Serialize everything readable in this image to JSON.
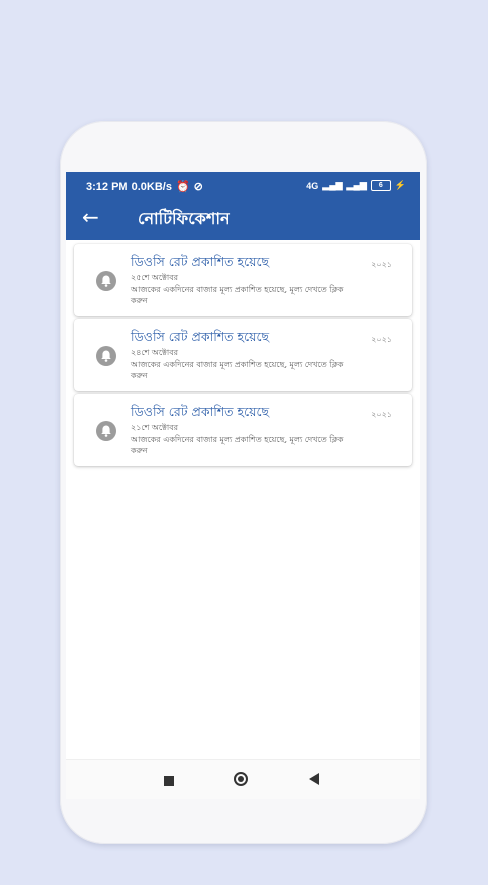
{
  "status": {
    "time": "3:12 PM",
    "speed": "0.0KB/s",
    "signal": "4G",
    "battery": "6"
  },
  "appbar": {
    "title": "নোটিফিকেশান"
  },
  "notifications": [
    {
      "title": "ডিওসি রেট প্রকাশিত হয়েছে",
      "date": "২৫শে অক্টোবর",
      "body": "আজকের একদিনের বাজার মূল্য প্রকাশিত হয়েছে, মূল্য দেখতে ক্লিক করুন",
      "year": "২০২১"
    },
    {
      "title": "ডিওসি রেট প্রকাশিত হয়েছে",
      "date": "২৪শে অক্টোবর",
      "body": "আজকের একদিনের বাজার মূল্য প্রকাশিত হয়েছে, মূল্য দেখতে ক্লিক করুন",
      "year": "২০২১"
    },
    {
      "title": "ডিওসি রেট প্রকাশিত হয়েছে",
      "date": "২১শে অক্টোবর",
      "body": "আজকের একদিনের বাজার মূল্য প্রকাশিত হয়েছে, মূল্য দেখতে ক্লিক করুন",
      "year": "২০২১"
    }
  ],
  "colors": {
    "primary": "#2a5ca8",
    "background": "#dfe4f6",
    "bell": "#9c9c9c"
  },
  "icons": {
    "back": "arrow-left-icon",
    "bell": "bell-icon",
    "nav_recent": "square-icon",
    "nav_home": "circle-icon",
    "nav_back": "triangle-back-icon"
  }
}
